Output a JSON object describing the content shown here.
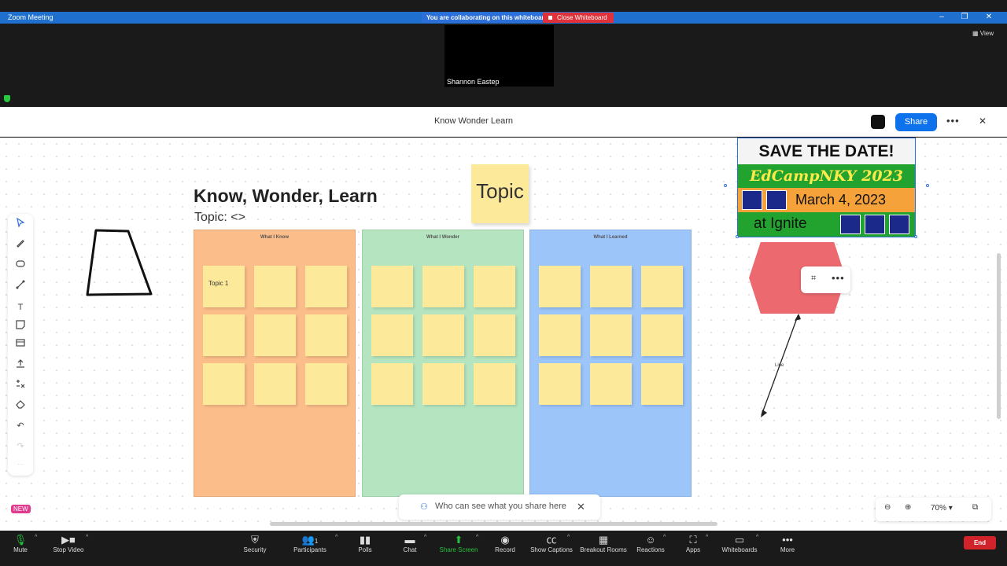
{
  "window": {
    "app_title": "Zoom Meeting",
    "collab_banner": "You are collaborating on this whiteboard",
    "close_whiteboard": "Close Whiteboard",
    "view_label": "View"
  },
  "participant": {
    "name": "Shannon Eastep"
  },
  "whiteboard": {
    "title": "Know Wonder Learn",
    "share_label": "Share",
    "board_title": "Know, Wonder, Learn",
    "topic_line": "Topic: <>",
    "topic_note": "Topic",
    "new_badge": "NEW",
    "columns": [
      {
        "header": "What I Know",
        "color": "#fbbd8a",
        "first_note": "Topic 1"
      },
      {
        "header": "What I Wonder",
        "color": "#b4e5c0",
        "first_note": ""
      },
      {
        "header": "What I Learned",
        "color": "#9cc5f9",
        "first_note": ""
      }
    ],
    "poster": {
      "line1": "SAVE THE DATE!",
      "line2": "EdCampNKY 2023",
      "line3": "March 4, 2023",
      "line4": "at Ignite"
    },
    "line_label": "Line",
    "privacy_text": "Who can see what you share here",
    "zoom_level": "70%"
  },
  "toolbar": {
    "mute": "Mute",
    "stop_video": "Stop Video",
    "security": "Security",
    "participants": "Participants",
    "participant_count": "1",
    "polls": "Polls",
    "chat": "Chat",
    "share_screen": "Share Screen",
    "record": "Record",
    "show_captions": "Show Captions",
    "breakout_rooms": "Breakout Rooms",
    "reactions": "Reactions",
    "apps": "Apps",
    "whiteboards": "Whiteboards",
    "more": "More",
    "end": "End"
  }
}
